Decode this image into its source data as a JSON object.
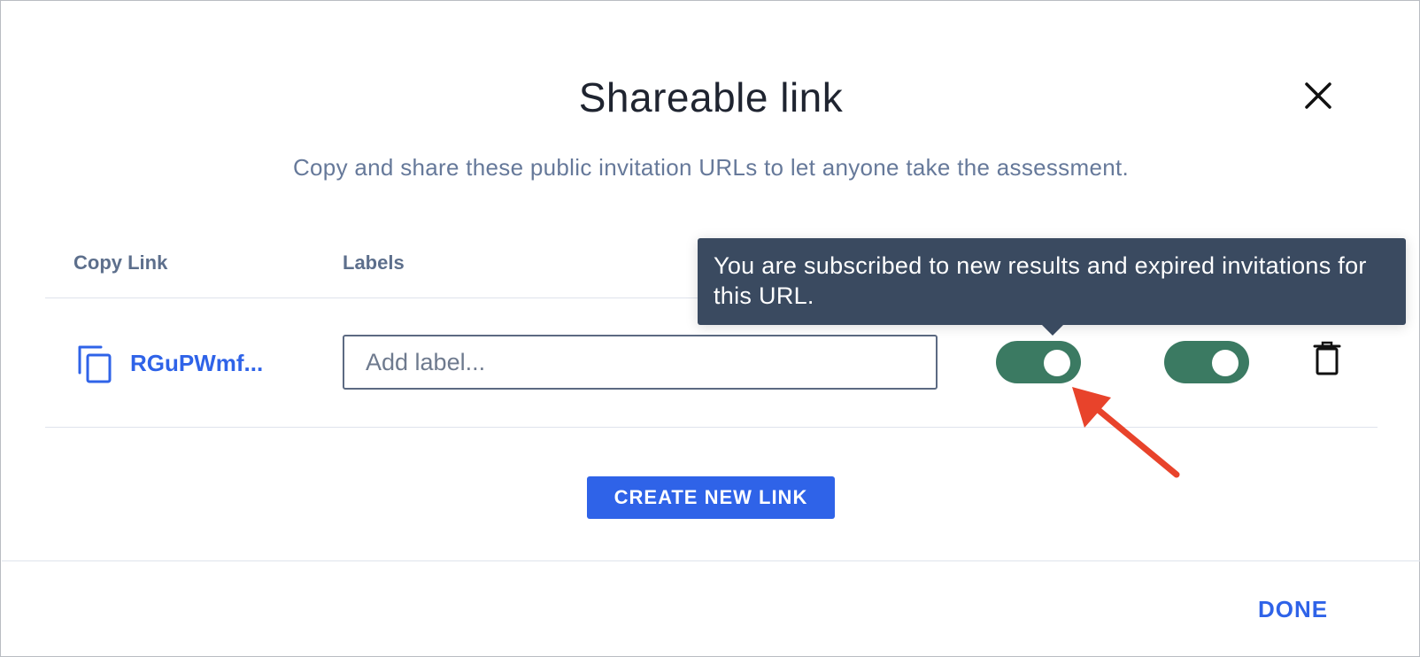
{
  "dialog": {
    "title": "Shareable link",
    "subtitle": "Copy and share these public invitation URLs to let anyone take the assessment.",
    "close_icon": "close-icon"
  },
  "table": {
    "headers": {
      "copy_link": "Copy Link",
      "labels": "Labels"
    },
    "rows": [
      {
        "link_text": "RGuPWmf...",
        "label_placeholder": "Add label...",
        "label_value": "",
        "notifications_on": true,
        "second_toggle_on": true
      }
    ]
  },
  "tooltip": {
    "text": "You are subscribed to new results and expired invitations for this URL."
  },
  "actions": {
    "create_label": "CREATE NEW LINK",
    "done_label": "DONE"
  },
  "colors": {
    "accent": "#2f63e8",
    "toggle_on": "#3b7a62",
    "tooltip_bg": "#3a4a60",
    "annotation_arrow": "#e8432b"
  }
}
